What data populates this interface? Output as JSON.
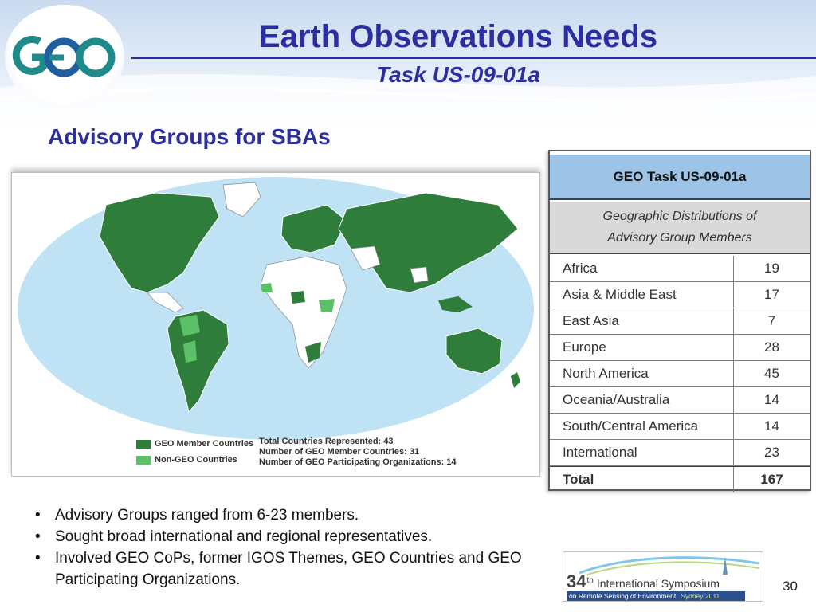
{
  "slide": {
    "title": "Earth Observations Needs",
    "subtitle": "Task US-09-01a",
    "logo_text": "GEO",
    "section_heading": "Advisory Groups for SBAs",
    "page_number": "30"
  },
  "map": {
    "legend": [
      {
        "label": "GEO Member Countries",
        "color": "#2e7d3a"
      },
      {
        "label": "Non-GEO Countries",
        "color": "#5cc069"
      }
    ],
    "stats": [
      "Total Countries Represented: 43",
      "Number of GEO Member Countries: 31",
      "Number of GEO Participating Organizations: 14"
    ],
    "colors": {
      "ocean": "#bfe3f4",
      "member": "#2e7d3a",
      "non_geo": "#5cc069",
      "other": "#ffffff"
    }
  },
  "table": {
    "header": "GEO Task US-09-01a",
    "subheader_line1": "Geographic Distributions of",
    "subheader_line2": "Advisory Group Members",
    "rows": [
      {
        "region": "Africa",
        "count": "19"
      },
      {
        "region": "Asia & Middle East",
        "count": "17"
      },
      {
        "region": "East Asia",
        "count": "7"
      },
      {
        "region": "Europe",
        "count": "28"
      },
      {
        "region": "North America",
        "count": "45"
      },
      {
        "region": "Oceania/Australia",
        "count": "14"
      },
      {
        "region": "South/Central America",
        "count": "14"
      },
      {
        "region": "International",
        "count": "23"
      }
    ],
    "total": {
      "region": "Total",
      "count": "167"
    }
  },
  "bullets": [
    "Advisory Groups ranged from 6-23 members.",
    "Sought broad international and regional representatives.",
    "Involved GEO CoPs, former IGOS Themes, GEO Countries and GEO Participating Organizations."
  ],
  "banner": {
    "number": "34",
    "suffix": "th",
    "line1": "International Symposium",
    "line2": "on Remote Sensing of Environment",
    "city": "Sydney 2011"
  },
  "colors": {
    "title": "#2b2e9f",
    "table_header": "#9dc3e6",
    "table_sub": "#d9d9d9"
  }
}
